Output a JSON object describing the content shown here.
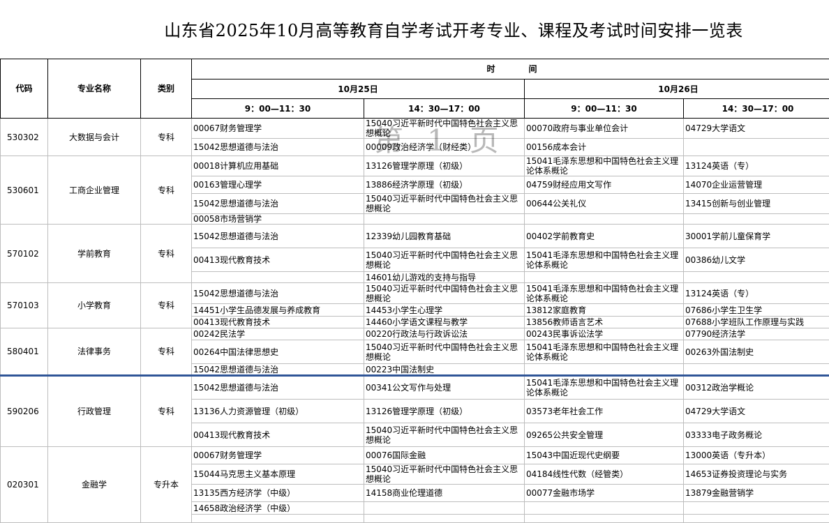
{
  "title": "山东省2025年10月高等教育自学考试开考专业、课程及考试时间安排一览表",
  "watermark": "第1页",
  "header": {
    "code": "代码",
    "major": "专业名称",
    "category": "类别",
    "time": "时　　　　间",
    "date1": "10月25日",
    "date2": "10月26日",
    "am": "9：00—11：30",
    "pm": "14：30—17：00"
  },
  "majors": [
    {
      "code": "530302",
      "name": "大数据与会计",
      "category": "专科",
      "rows": [
        [
          "00067财务管理学",
          "15040习近平新时代中国特色社会主义思想概论",
          "00070政府与事业单位会计",
          "04729大学语文"
        ],
        [
          "15042思想道德与法治",
          "00009政治经济学（财经类）",
          "00156成本会计",
          ""
        ]
      ]
    },
    {
      "code": "530601",
      "name": "工商企业管理",
      "category": "专科",
      "rows": [
        [
          "00018计算机应用基础",
          "13126管理学原理（初级）",
          "15041毛泽东思想和中国特色社会主义理论体系概论",
          "13124英语（专）"
        ],
        [
          "00163管理心理学",
          "13886经济学原理（初级）",
          "04759财经应用文写作",
          "14070企业运营管理"
        ],
        [
          "15042思想道德与法治",
          "15040习近平新时代中国特色社会主义思想概论",
          "00644公关礼仪",
          "13415创新与创业管理"
        ],
        [
          "00058市场营销学",
          "",
          "",
          ""
        ]
      ]
    },
    {
      "code": "570102",
      "name": "学前教育",
      "category": "专科",
      "rows": [
        [
          "15042思想道德与法治",
          "12339幼儿园教育基础",
          "00402学前教育史",
          "30001学前儿童保育学"
        ],
        [
          "00413现代教育技术",
          "15040习近平新时代中国特色社会主义思想概论",
          "15041毛泽东思想和中国特色社会主义理论体系概论",
          "00386幼儿文学"
        ],
        [
          "",
          "14601幼儿游戏的支持与指导",
          "",
          ""
        ]
      ]
    },
    {
      "code": "570103",
      "name": "小学教育",
      "category": "专科",
      "rows": [
        [
          "15042思想道德与法治",
          "15040习近平新时代中国特色社会主义思想概论",
          "15041毛泽东思想和中国特色社会主义理论体系概论",
          "13124英语（专）"
        ],
        [
          "14451小学生品德发展与养成教育",
          "14453小学生心理学",
          "13812家庭教育",
          "07686小学生卫生学"
        ],
        [
          "00413现代教育技术",
          "14460小学语文课程与教学",
          "13856教师语言艺术",
          "07688小学班队工作原理与实践"
        ]
      ]
    },
    {
      "code": "580401",
      "name": "法律事务",
      "category": "专科",
      "rows": [
        [
          "00242民法学",
          "00220行政法与行政诉讼法",
          "00243民事诉讼法学",
          "07790经济法学"
        ],
        [
          "00264中国法律思想史",
          "15040习近平新时代中国特色社会主义思想概论",
          "15041毛泽东思想和中国特色社会主义理论体系概论",
          "00263外国法制史"
        ],
        [
          "15042思想道德与法治",
          "00223中国法制史",
          "",
          ""
        ]
      ]
    },
    {
      "code": "590206",
      "name": "行政管理",
      "category": "专科",
      "rows": [
        [
          "15042思想道德与法治",
          "00341公文写作与处理",
          "15041毛泽东思想和中国特色社会主义理论体系概论",
          "00312政治学概论"
        ],
        [
          "13136人力资源管理（初级）",
          "13126管理学原理（初级）",
          "03573老年社会工作",
          "04729大学语文"
        ],
        [
          "00413现代教育技术",
          "15040习近平新时代中国特色社会主义思想概论",
          "09265公共安全管理",
          "03333电子政务概论"
        ]
      ]
    },
    {
      "code": "020301",
      "name": "金融学",
      "category": "专升本",
      "rows": [
        [
          "00067财务管理学",
          "00076国际金融",
          "15043中国近现代史纲要",
          "13000英语（专升本）"
        ],
        [
          "15044马克思主义基本原理",
          "15040习近平新时代中国特色社会主义思想概论",
          "04184线性代数（经管类）",
          "14653证券投资理论与实务"
        ],
        [
          "13135西方经济学（中级）",
          "14158商业伦理道德",
          "00077金融市场学",
          "13879金融营销学"
        ],
        [
          "14658政治经济学（中级）",
          "",
          "",
          ""
        ],
        [
          "",
          "",
          "",
          ""
        ]
      ]
    }
  ]
}
